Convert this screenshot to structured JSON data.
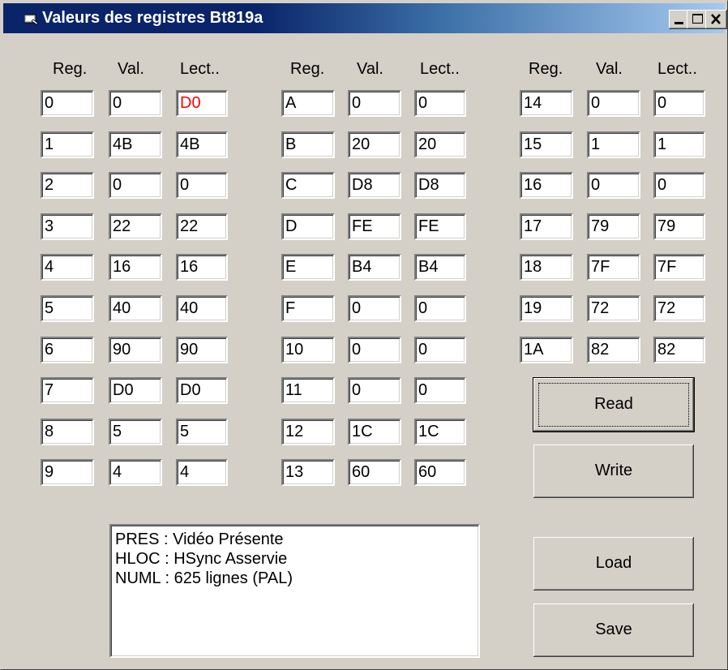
{
  "window": {
    "title": "Valeurs des registres Bt819a"
  },
  "title_buttons": [
    "minimize",
    "maximize",
    "close"
  ],
  "headers": {
    "reg": "Reg.",
    "val": "Val.",
    "lect": "Lect.."
  },
  "groups": [
    {
      "rows": [
        {
          "reg": "0",
          "val": "0",
          "lect": "D0"
        },
        {
          "reg": "1",
          "val": "4B",
          "lect": "4B"
        },
        {
          "reg": "2",
          "val": "0",
          "lect": "0"
        },
        {
          "reg": "3",
          "val": "22",
          "lect": "22"
        },
        {
          "reg": "4",
          "val": "16",
          "lect": "16"
        },
        {
          "reg": "5",
          "val": "40",
          "lect": "40"
        },
        {
          "reg": "6",
          "val": "90",
          "lect": "90"
        },
        {
          "reg": "7",
          "val": "D0",
          "lect": "D0"
        },
        {
          "reg": "8",
          "val": "5",
          "lect": "5"
        },
        {
          "reg": "9",
          "val": "4",
          "lect": "4"
        }
      ]
    },
    {
      "rows": [
        {
          "reg": "A",
          "val": "0",
          "lect": "0"
        },
        {
          "reg": "B",
          "val": "20",
          "lect": "20"
        },
        {
          "reg": "C",
          "val": "D8",
          "lect": "D8"
        },
        {
          "reg": "D",
          "val": "FE",
          "lect": "FE"
        },
        {
          "reg": "E",
          "val": "B4",
          "lect": "B4"
        },
        {
          "reg": "F",
          "val": "0",
          "lect": "0"
        },
        {
          "reg": "10",
          "val": "0",
          "lect": "0"
        },
        {
          "reg": "11",
          "val": "0",
          "lect": "0"
        },
        {
          "reg": "12",
          "val": "1C",
          "lect": "1C"
        },
        {
          "reg": "13",
          "val": "60",
          "lect": "60"
        }
      ]
    },
    {
      "rows": [
        {
          "reg": "14",
          "val": "0",
          "lect": "0"
        },
        {
          "reg": "15",
          "val": "1",
          "lect": "1"
        },
        {
          "reg": "16",
          "val": "0",
          "lect": "0"
        },
        {
          "reg": "17",
          "val": "79",
          "lect": "79"
        },
        {
          "reg": "18",
          "val": "7F",
          "lect": "7F"
        },
        {
          "reg": "19",
          "val": "72",
          "lect": "72"
        },
        {
          "reg": "1A",
          "val": "82",
          "lect": "82"
        }
      ]
    }
  ],
  "mismatch_color": "#ff0000",
  "buttons": {
    "read": "Read",
    "write": "Write",
    "load": "Load",
    "save": "Save"
  },
  "status_lines": [
    "PRES : Vidéo Présente",
    "HLOC : HSync Asservie",
    "NUML : 625 lignes (PAL)"
  ]
}
